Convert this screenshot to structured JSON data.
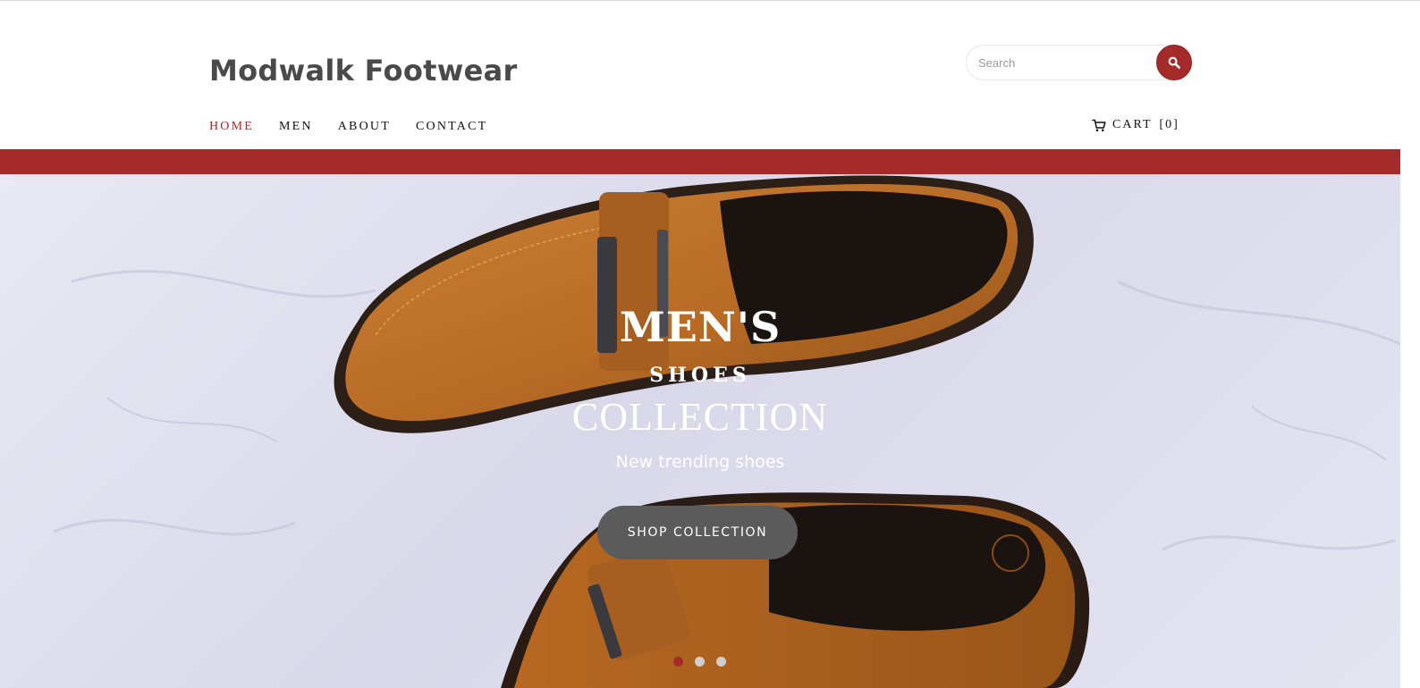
{
  "header": {
    "brand": "Modwalk Footwear",
    "search": {
      "placeholder": "Search",
      "value": ""
    },
    "nav": [
      {
        "label": "HOME",
        "active": true
      },
      {
        "label": "MEN",
        "active": false
      },
      {
        "label": "ABOUT",
        "active": false
      },
      {
        "label": "CONTACT",
        "active": false
      }
    ],
    "cart": {
      "label": "CART",
      "count": "[0]"
    }
  },
  "hero": {
    "title": "MEN'S",
    "subtitle": "SHOES",
    "collection": "COLLECTION",
    "tagline": "New trending shoes",
    "cta": "SHOP COLLECTION",
    "slides": {
      "count": 3,
      "active_index": 0
    }
  },
  "colors": {
    "accent": "#a52a2a",
    "text": "#111111",
    "brand_text": "#4a4a4a",
    "cta_bg": "#5b5b5b",
    "dot_active": "#a52a2a",
    "dot_inactive": "#cfcfcf"
  },
  "icons": {
    "search": "search-icon",
    "cart": "cart-icon"
  }
}
